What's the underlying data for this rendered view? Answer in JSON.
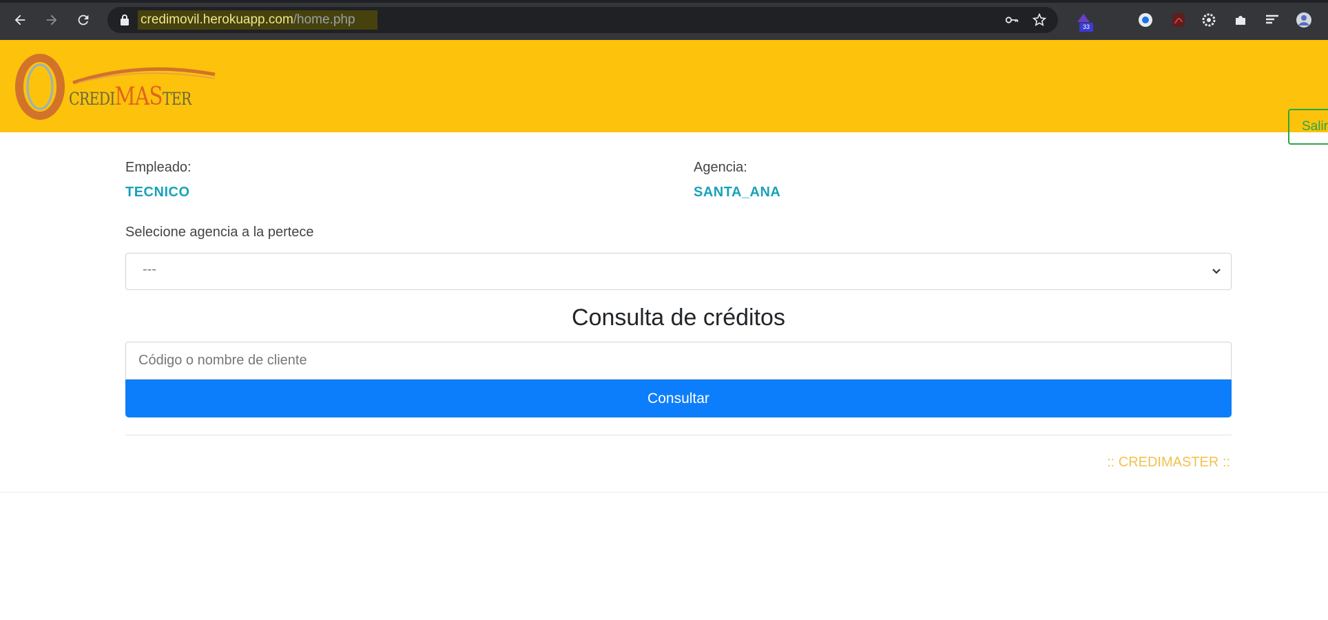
{
  "browser": {
    "url_host": "credimovil.herokuapp.com",
    "url_path": "/home.php",
    "extension_badge": "33",
    "colors": {
      "chrome": "#35363a",
      "omnibox": "#202124"
    }
  },
  "navbar": {
    "brand_part1": "CREDI",
    "brand_part2": "MAS",
    "brand_part3": "TER",
    "logout_label": "Salir",
    "colors": {
      "background": "#fdc20c",
      "logout": "#28a745"
    }
  },
  "info": {
    "employee_label": "Empleado:",
    "employee_value": "TECNICO",
    "agency_label": "Agencia:",
    "agency_value": "SANTA_ANA",
    "value_color": "#17a2b8"
  },
  "agency_select": {
    "label": "Selecione agencia a la pertece",
    "selected": "---"
  },
  "search": {
    "heading": "Consulta de créditos",
    "placeholder": "Código o nombre de cliente",
    "button_label": "Consultar",
    "button_color": "#0d7efb"
  },
  "footer": {
    "text": ":: CREDIMASTER ::",
    "color": "#f2c14e"
  }
}
